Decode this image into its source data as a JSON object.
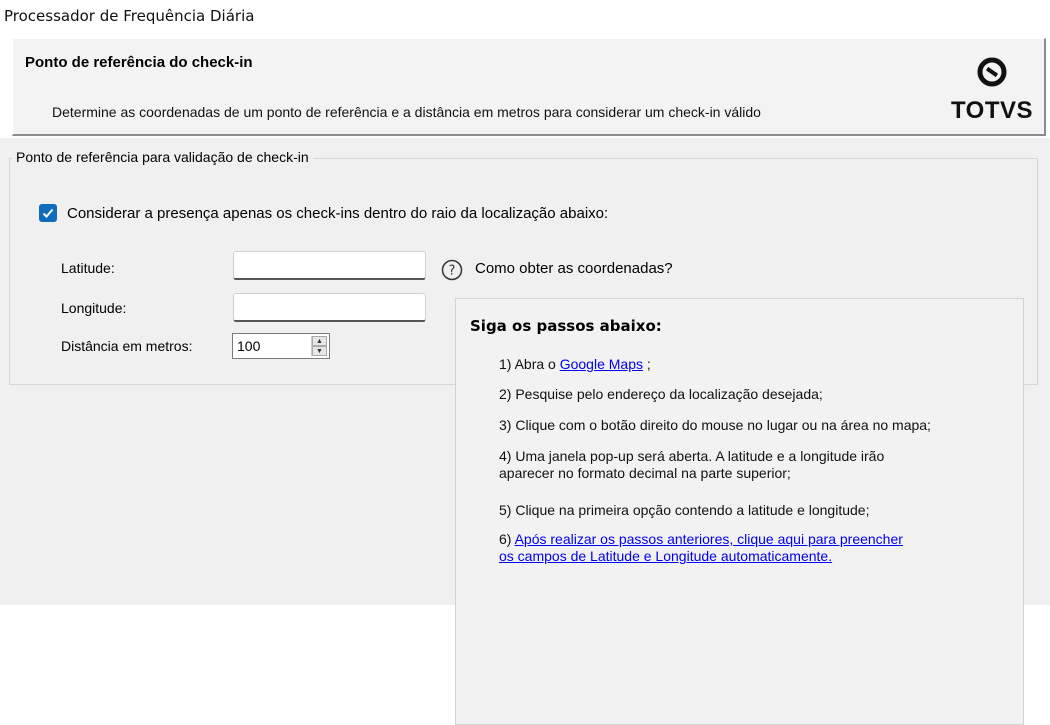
{
  "window": {
    "title": "Processador de Frequência Diária"
  },
  "header": {
    "title": "Ponto de referência do check-in",
    "description": "Determine as coordenadas de um ponto de referência e a distância em metros para considerar um check-in válido",
    "logo_text": "TOTVS"
  },
  "group": {
    "legend": "Ponto de referência para validação de check-in",
    "checkbox_label": "Considerar a presença apenas os check-ins dentro do raio da localização abaixo:",
    "checkbox_checked": true,
    "latitude_label": "Latitude:",
    "latitude_value": "",
    "longitude_label": "Longitude:",
    "longitude_value": "",
    "distance_label": "Distância em metros:",
    "distance_value": "100",
    "help_text": "Como obter as coordenadas?"
  },
  "steps": {
    "title": "Siga os passos abaixo:",
    "step1_prefix": "1) Abra o",
    "step1_link": "Google Maps",
    "step1_suffix": ";",
    "step2": "2) Pesquise pelo endereço da localização desejada;",
    "step3": "3) Clique com o botão direito do mouse no lugar ou na área no mapa;",
    "step4_line1": "4) Uma janela pop-up será aberta. A latitude e a longitude irão",
    "step4_line2": "aparecer no formato decimal na parte superior;",
    "step5": "5) Clique na primeira opção contendo a latitude e longitude;",
    "step6_prefix": "6)",
    "step6_link_line1": "Após realizar os passos anteriores, clique aqui para preencher",
    "step6_link_line2": "os campos de Latitude e Longitude automaticamente."
  },
  "colors": {
    "accent": "#0f6cbd",
    "link": "#0000ee",
    "panel_bg": "#f0f0f0"
  }
}
